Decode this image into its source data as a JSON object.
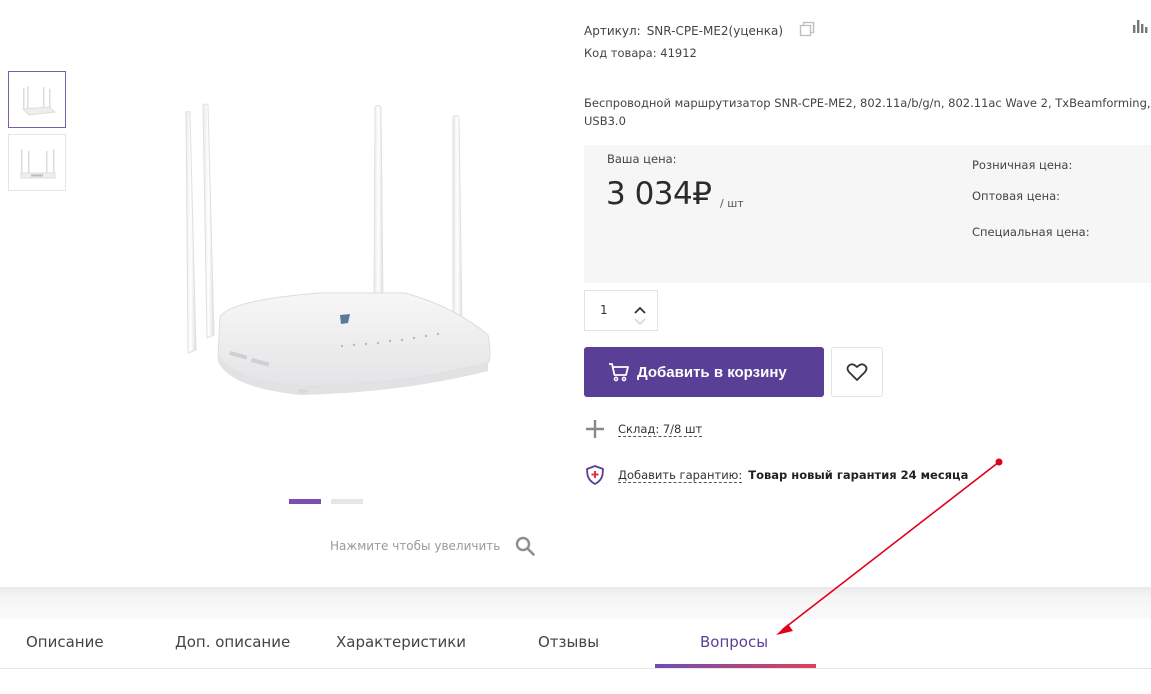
{
  "product": {
    "sku_label": "Артикул:",
    "sku_value": "SNR-CPE-ME2(уценка)",
    "code_label": "Код товара:",
    "code_value": "41912",
    "description": "Беспроводной маршрутизатор SNR-CPE-ME2, 802.11a/b/g/n, 802.11ac Wave 2, TxBeamforming, USB3.0"
  },
  "price": {
    "your_price_label": "Ваша цена:",
    "value": "3 034₽",
    "unit": "/ шт",
    "retail_label": "Розничная цена:",
    "wholesale_label": "Оптовая цена:",
    "special_label": "Специальная цена:"
  },
  "quantity": {
    "value": "1"
  },
  "actions": {
    "add_to_cart": "Добавить в корзину"
  },
  "stock": {
    "label": "Склад: 7/8 шт"
  },
  "warranty": {
    "link": "Добавить гарантию:",
    "text": "Товар новый гарантия 24 месяца"
  },
  "gallery": {
    "zoom_hint": "Нажмите чтобы увеличить",
    "thumbnails": 2,
    "active_slide": 1
  },
  "tabs": {
    "items": [
      {
        "label": "Описание"
      },
      {
        "label": "Доп. описание"
      },
      {
        "label": "Характеристики"
      },
      {
        "label": "Отзывы"
      },
      {
        "label": "Вопросы"
      }
    ],
    "active": "Вопросы"
  },
  "colors": {
    "accent": "#5a3f96",
    "annotation": "#e0001b"
  },
  "icons": [
    "copy-icon",
    "compare-icon",
    "chevron-up-icon",
    "chevron-down-icon",
    "cart-icon",
    "heart-icon",
    "plus-icon",
    "shield-icon",
    "search-icon"
  ]
}
